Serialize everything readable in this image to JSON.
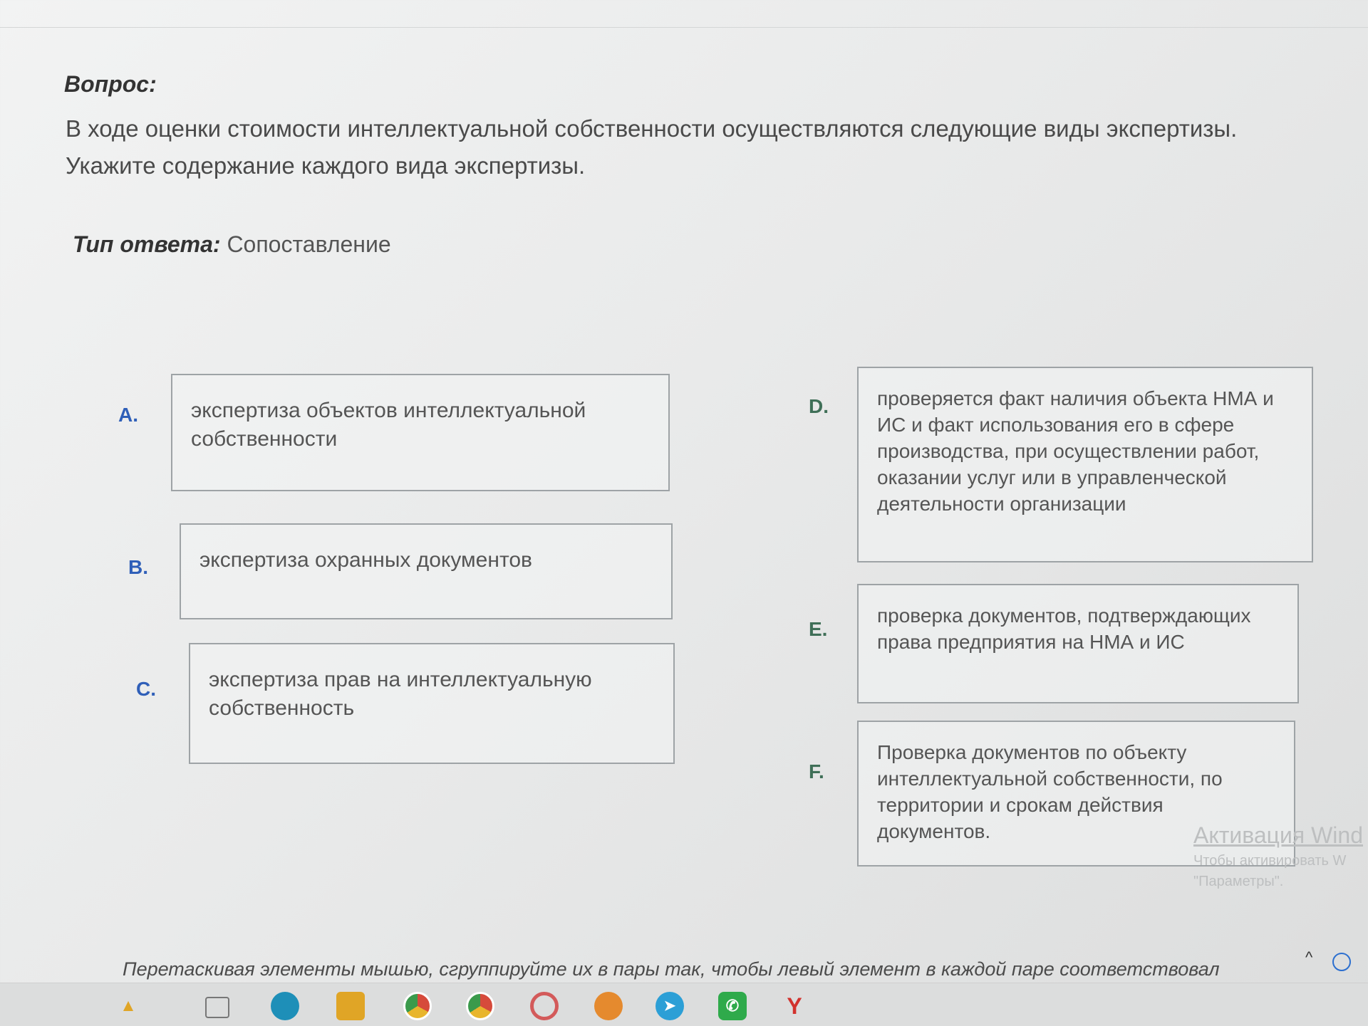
{
  "question": {
    "heading": "Вопрос:",
    "text": "В ходе оценки стоимости интеллектуальной собственности осуществляются следующие виды экспертизы. Укажите содержание каждого вида экспертизы."
  },
  "answer_type": {
    "label": "Тип ответа:",
    "value": "Сопоставление"
  },
  "left_items": [
    {
      "letter": "A.",
      "text": "экспертиза объектов интеллектуальной собственности"
    },
    {
      "letter": "B.",
      "text": "экспертиза охранных документов"
    },
    {
      "letter": "C.",
      "text": "экспертиза прав на интеллектуальную собственность"
    }
  ],
  "right_items": [
    {
      "letter": "D.",
      "text": "проверяется факт наличия объекта НМА и ИС и факт использования его в сфере производства, при осуществлении работ, оказании услуг или в управленческой деятельности организации"
    },
    {
      "letter": "E.",
      "text": "проверка документов, подтверждающих права предприятия на НМА и ИС"
    },
    {
      "letter": "F.",
      "text": "Проверка документов по объекту интеллектуальной собственности, по территории  и срокам действия документов."
    }
  ],
  "instruction": "Перетаскивая элементы мышью, сгруппируйте их в пары так, чтобы левый элемент в каждой паре соответствовал",
  "watermark": {
    "title": "Активация Wind",
    "line1": "Чтобы активировать W",
    "line2": "\"Параметры\"."
  },
  "taskbar": {
    "icons": [
      "windows-icon",
      "task-view-icon",
      "edge-icon",
      "folder-icon",
      "chrome-icon",
      "chrome-icon",
      "opera-icon",
      "mail-icon",
      "telegram-icon",
      "whatsapp-icon",
      "yandex-icon"
    ],
    "yandex_letter": "Y"
  },
  "colors": {
    "left_letters": "#2f5fb8",
    "right_letters": "#3f6f57"
  }
}
